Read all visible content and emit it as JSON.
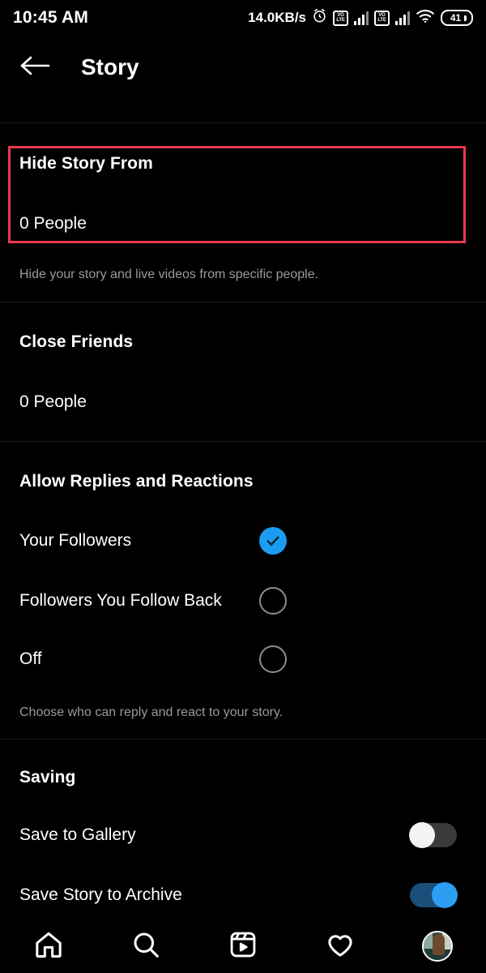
{
  "status_bar": {
    "clock": "10:45 AM",
    "network_speed": "14.0KB/s",
    "alarm_icon": "alarm-clock-icon",
    "sim1_volte_line1": "VO",
    "sim1_volte_line2": "LTE",
    "sim2_volte_line1": "VO",
    "sim2_volte_line2": "LTE",
    "wifi_icon": "wifi-icon",
    "battery_level": "41"
  },
  "header": {
    "back_icon": "back-arrow-icon",
    "title": "Story"
  },
  "sections": {
    "hide_story": {
      "title": "Hide Story From",
      "value": "0 People",
      "helper": "Hide your story and live videos from specific people.",
      "highlight_color": "#e8384f"
    },
    "close_friends": {
      "title": "Close Friends",
      "value": "0 People"
    },
    "allow_replies": {
      "title": "Allow Replies and Reactions",
      "helper": "Choose who can reply and react to your story.",
      "options": [
        {
          "label": "Your Followers",
          "selected": "true"
        },
        {
          "label": "Followers You Follow Back",
          "selected": "false"
        },
        {
          "label": "Off",
          "selected": "false"
        }
      ]
    },
    "saving": {
      "title": "Saving",
      "toggles": [
        {
          "label": "Save to Gallery",
          "state": "off"
        },
        {
          "label": "Save Story to Archive",
          "state": "on"
        }
      ]
    }
  },
  "bottom_nav": {
    "items": [
      {
        "icon": "home-icon",
        "name": "home"
      },
      {
        "icon": "search-icon",
        "name": "search"
      },
      {
        "icon": "reels-icon",
        "name": "reels"
      },
      {
        "icon": "heart-icon",
        "name": "activity"
      },
      {
        "icon": "profile-avatar",
        "name": "profile"
      }
    ]
  },
  "colors": {
    "accent_blue": "#1c9cf0",
    "background": "#000000",
    "helper_text": "#9a9a9a"
  }
}
